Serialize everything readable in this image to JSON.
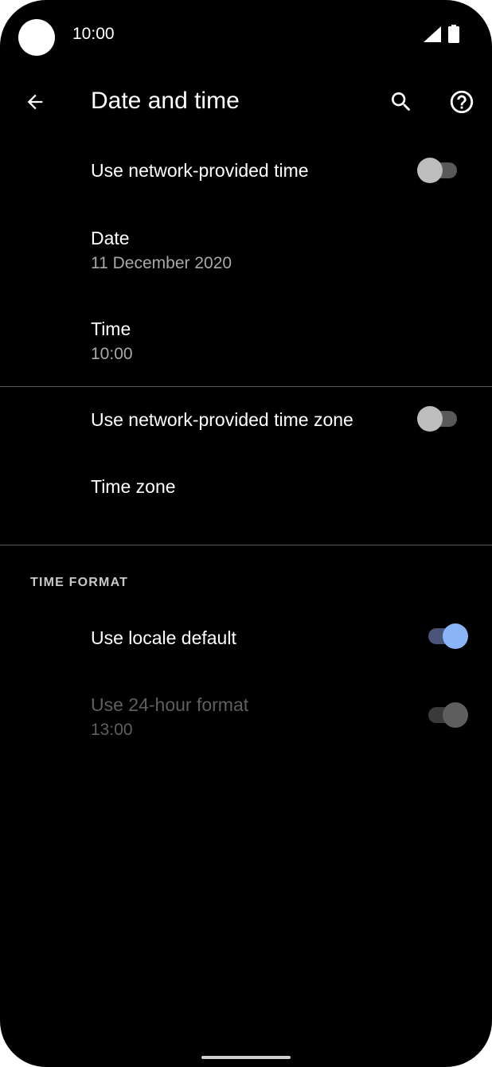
{
  "status_bar": {
    "time": "10:00",
    "signal_icon": "signal-icon",
    "battery_icon": "battery-icon"
  },
  "app_bar": {
    "back_icon": "arrow-back-icon",
    "title": "Date and time",
    "search_icon": "search-icon",
    "help_icon": "help-icon"
  },
  "settings": {
    "network_time": {
      "title": "Use network-provided time",
      "enabled": false
    },
    "date": {
      "title": "Date",
      "value": "11 December 2020"
    },
    "time": {
      "title": "Time",
      "value": "10:00"
    },
    "network_time_zone": {
      "title": "Use network-provided time zone",
      "enabled": false
    },
    "time_zone": {
      "title": "Time zone"
    }
  },
  "time_format": {
    "header": "TIME FORMAT",
    "locale_default": {
      "title": "Use locale default",
      "enabled": true
    },
    "hour24": {
      "title": "Use 24-hour format",
      "value": "13:00",
      "enabled": true,
      "disabled": true
    }
  },
  "colors": {
    "background": "#000000",
    "accent": "#8ab4f8",
    "secondary_text": "#a8a8a8",
    "disabled_text": "#5f5f5f"
  }
}
